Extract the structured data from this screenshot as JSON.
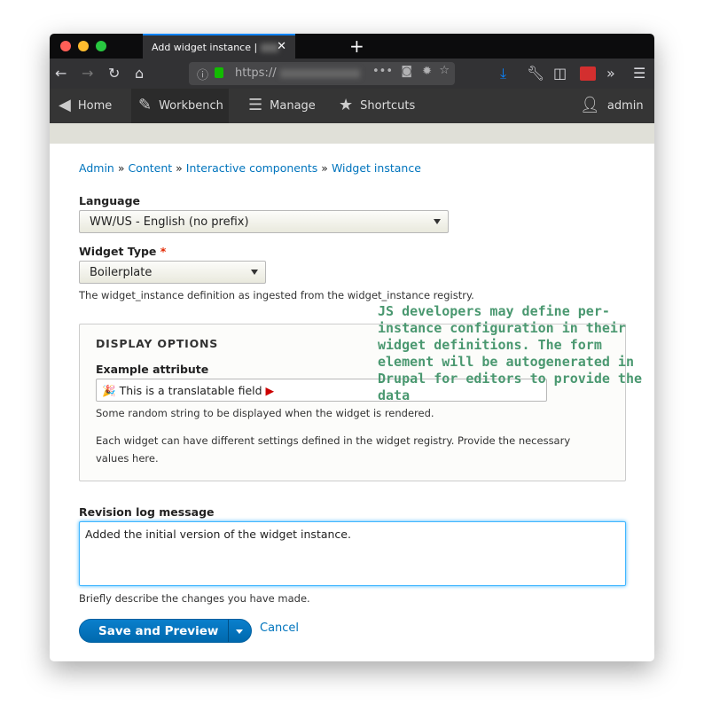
{
  "browser": {
    "tab_title": "Add widget instance |",
    "url": "https://",
    "colors": {
      "close": "#ff5f57",
      "min": "#febc2e",
      "max": "#28c840"
    }
  },
  "toolbar": {
    "home": "Home",
    "workbench": "Workbench",
    "manage": "Manage",
    "shortcuts": "Shortcuts",
    "user": "admin"
  },
  "breadcrumb": [
    "Admin",
    "Content",
    "Interactive components",
    "Widget instance"
  ],
  "form": {
    "language_label": "Language",
    "language_value": "WW/US - English (no prefix)",
    "widget_type_label": "Widget Type",
    "required_mark": "*",
    "widget_type_value": "Boilerplate",
    "widget_type_desc": "The widget_instance definition as ingested from the widget_instance registry.",
    "display_options_title": "DISPLAY OPTIONS",
    "example_label": "Example attribute",
    "example_value": "This is a translatable field",
    "example_desc": "Some random string to be displayed when the widget is rendered.",
    "settings_desc": "Each widget can have different settings defined in the widget registry. Provide the necessary values here.",
    "revision_label": "Revision log message",
    "revision_value": "Added the initial version of the widget instance.",
    "revision_desc": "Briefly describe the changes you have made.",
    "save_label": "Save and Preview",
    "cancel_label": "Cancel"
  },
  "annotation": "JS developers may define per-instance configuration in their widget definitions. The form element will be autogenerated in Drupal for editors to provide the data"
}
